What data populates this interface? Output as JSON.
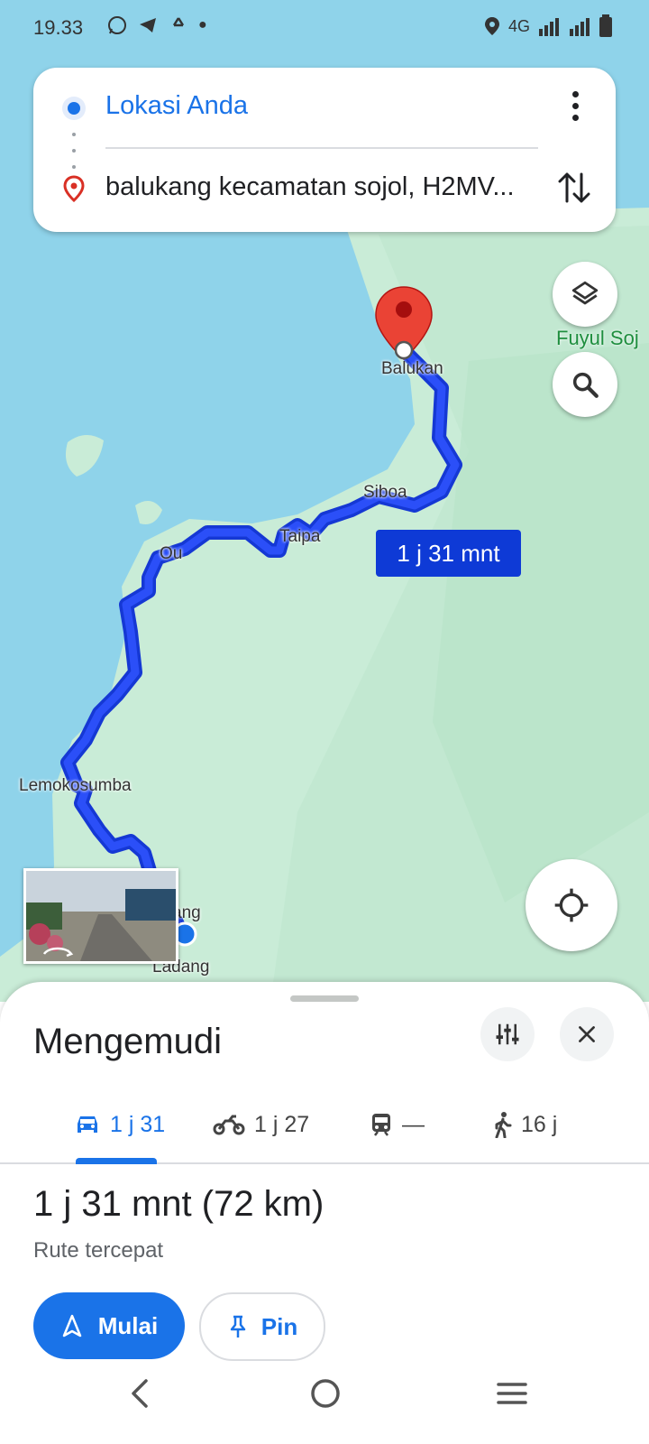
{
  "status_bar": {
    "time": "19.33",
    "network": "4G"
  },
  "directions": {
    "origin": "Lokasi Anda",
    "destination": "balukang kecamatan sojol, H2MV..."
  },
  "map": {
    "places": [
      "Balukan",
      "Fuyul Soj",
      "Siboa",
      "Taipa",
      "Ou",
      "Lemokosumba",
      "ang",
      "Ladang"
    ],
    "route_time_label": "1 j 31 mnt",
    "route_color": "#1a3df0"
  },
  "sheet": {
    "title": "Mengemudi",
    "modes": [
      {
        "icon": "car-icon",
        "label": "1 j 31"
      },
      {
        "icon": "motorcycle-icon",
        "label": "1 j 27"
      },
      {
        "icon": "train-icon",
        "label": "—"
      },
      {
        "icon": "walk-icon",
        "label": "16 j"
      }
    ],
    "summary": "1 j 31 mnt (72 km)",
    "route_note": "Rute tercepat",
    "start_label": "Mulai",
    "pin_label": "Pin"
  },
  "colors": {
    "accent": "#1a73e8",
    "destination_pin": "#d93025",
    "water": "#8fd3ea",
    "land": "#c9ecd7"
  }
}
